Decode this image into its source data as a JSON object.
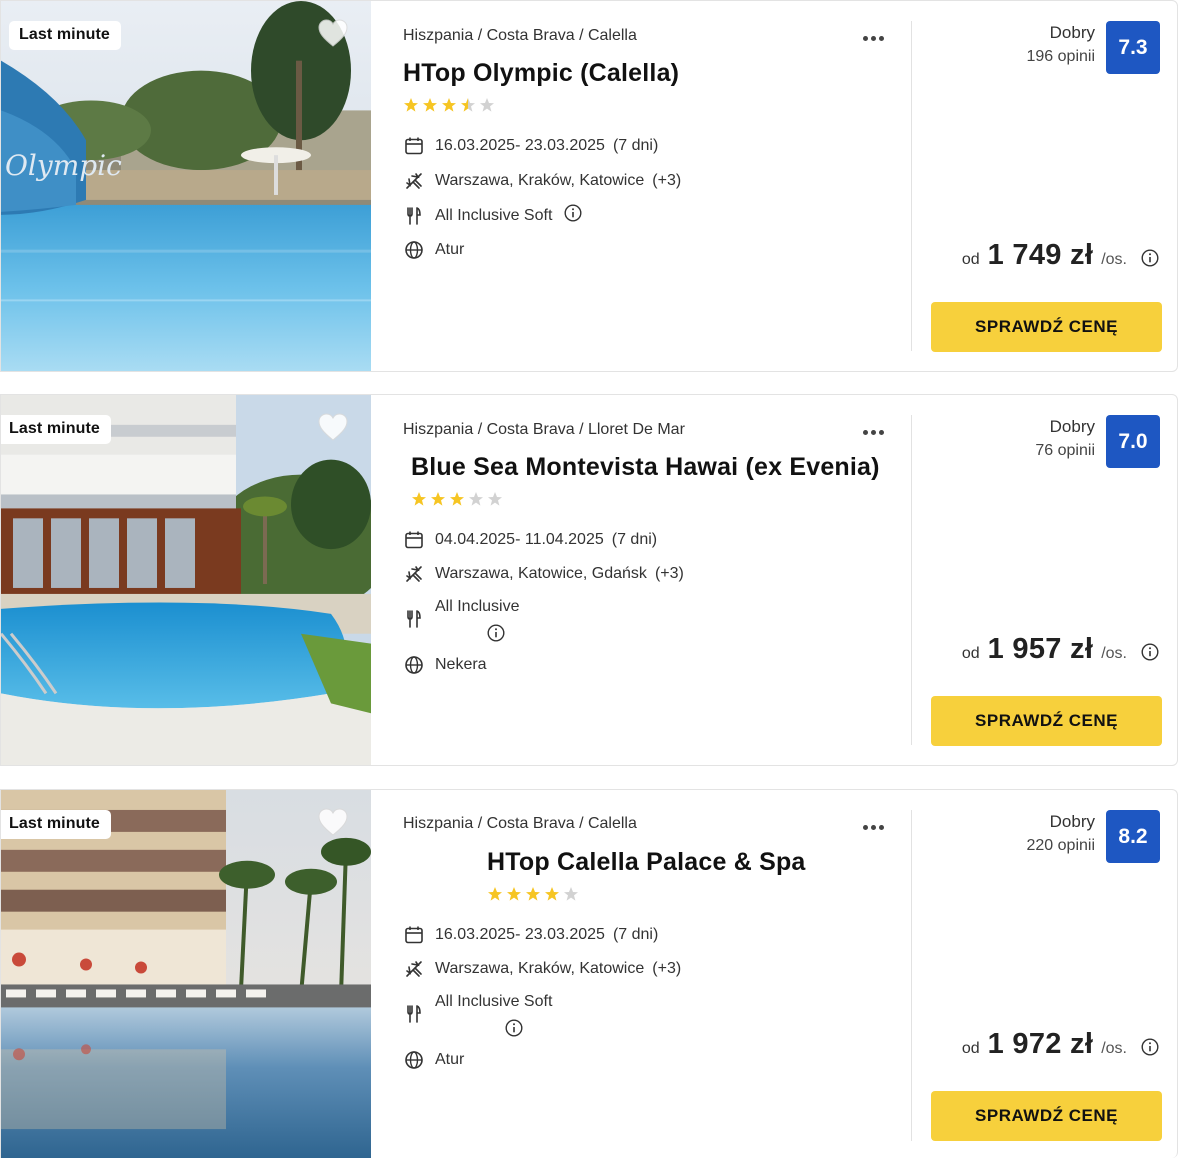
{
  "offers": [
    {
      "badge": "Last minute",
      "breadcrumb": "Hiszpania / Costa Brava / Calella",
      "hotel_name": "HTop Olympic (Calella)",
      "stars": 3.5,
      "dates": "16.03.2025- 23.03.2025",
      "duration": "(7 dni)",
      "departures": "Warszawa, Kraków, Katowice",
      "departures_more": "(+3)",
      "board": "All Inclusive Soft",
      "operator": "Atur",
      "rating_label": "Dobry",
      "rating_count": "196 opinii",
      "score": "7.3",
      "price_prefix": "od",
      "price": "1 749 zł",
      "price_suffix": "/os.",
      "cta": "SPRAWDŹ CENĘ"
    },
    {
      "badge": "Last minute",
      "breadcrumb": "Hiszpania / Costa Brava / Lloret De Mar",
      "hotel_name": "Blue Sea Montevista Hawai (ex Evenia)",
      "stars": 3,
      "dates": "04.04.2025- 11.04.2025",
      "duration": "(7 dni)",
      "departures": "Warszawa, Katowice, Gdańsk",
      "departures_more": "(+3)",
      "board": "All Inclusive",
      "operator": "Nekera",
      "rating_label": "Dobry",
      "rating_count": "76 opinii",
      "score": "7.0",
      "price_prefix": "od",
      "price": "1 957 zł",
      "price_suffix": "/os.",
      "cta": "SPRAWDŹ CENĘ"
    },
    {
      "badge": "Last minute",
      "breadcrumb": "Hiszpania / Costa Brava / Calella",
      "hotel_name": "HTop Calella Palace & Spa",
      "stars": 4,
      "dates": "16.03.2025- 23.03.2025",
      "duration": "(7 dni)",
      "departures": "Warszawa, Kraków, Katowice",
      "departures_more": "(+3)",
      "board": "All Inclusive Soft",
      "operator": "Atur",
      "rating_label": "Dobry",
      "rating_count": "220 opinii",
      "score": "8.2",
      "price_prefix": "od",
      "price": "1 972 zł",
      "price_suffix": "/os.",
      "cta": "SPRAWDŹ CENĘ"
    }
  ],
  "icons": {
    "favorite": "heart-icon",
    "more": "more-dots-icon",
    "dates": "calendar-icon",
    "departures": "plane-icon",
    "board": "cutlery-icon",
    "operator": "globe-icon",
    "info": "info-icon"
  },
  "colors": {
    "score_bg": "#1e57c2",
    "cta_bg": "#f7d03c",
    "star_filled": "#f6c523",
    "star_empty": "#d2d2d2"
  }
}
